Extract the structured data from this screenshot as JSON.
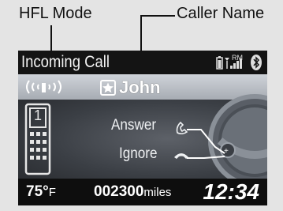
{
  "callouts": {
    "hfl_mode": "HFL Mode",
    "caller_name": "Caller Name"
  },
  "header": {
    "title": "Incoming Call",
    "roaming": "RM"
  },
  "caller": {
    "name": "John"
  },
  "call_options": {
    "answer_label": "Answer",
    "ignore_label": "Ignore"
  },
  "phone_icon_number": "1",
  "footer": {
    "temperature_value": "75°",
    "temperature_unit": "F",
    "odometer_value": "002300",
    "odometer_unit": "miles",
    "clock": "12:34"
  },
  "colors": {
    "screen_background": "#191919",
    "name_bar": "#bcc1c8",
    "text": "#ffffff"
  }
}
